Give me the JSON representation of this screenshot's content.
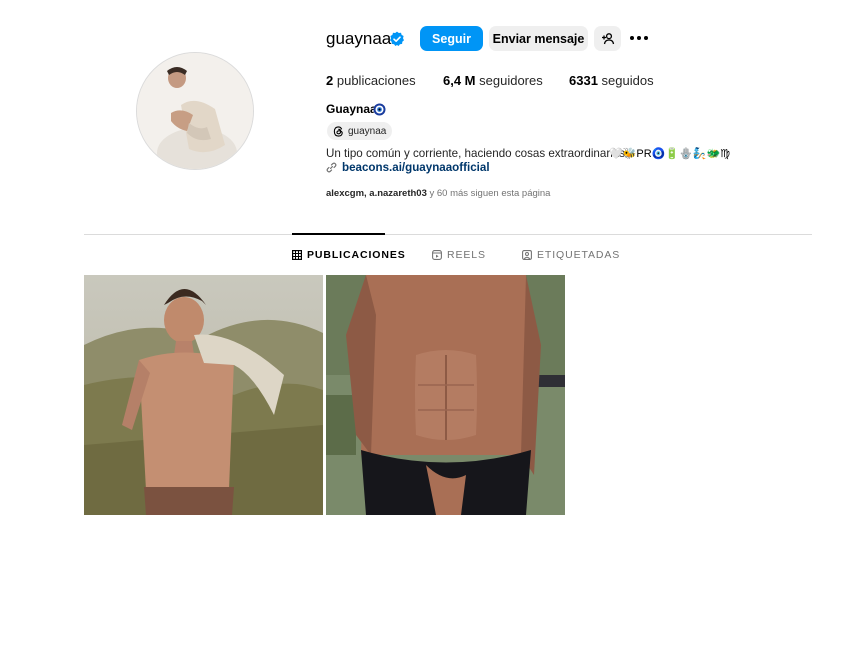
{
  "profile": {
    "username": "guaynaa",
    "full_name": "Guaynaa",
    "threads_handle": "guaynaa",
    "bio": "Un tipo común y corriente, haciendo cosas extraordinarias",
    "bio_emojis": "🤍🐝PR🧿🔋🪬🧞🐲♍",
    "link": "beacons.ai/guaynaaofficial",
    "followed_by": {
      "users": "alexcgm, a.nazareth03",
      "rest": " y 60 más siguen esta página"
    }
  },
  "actions": {
    "follow": "Seguir",
    "message": "Enviar mensaje"
  },
  "stats": {
    "posts_count": "2",
    "posts_label": "publicaciones",
    "followers_count": "6,4 M",
    "followers_label": "seguidores",
    "following_count": "6331",
    "following_label": "seguidos"
  },
  "tabs": [
    {
      "label": "PUBLICACIONES",
      "active": true
    },
    {
      "label": "REELS",
      "active": false
    },
    {
      "label": "ETIQUETADAS",
      "active": false
    }
  ],
  "colors": {
    "accent": "#0095f6",
    "verified": "#0095f6",
    "link": "#00376b",
    "muted": "#737373"
  }
}
